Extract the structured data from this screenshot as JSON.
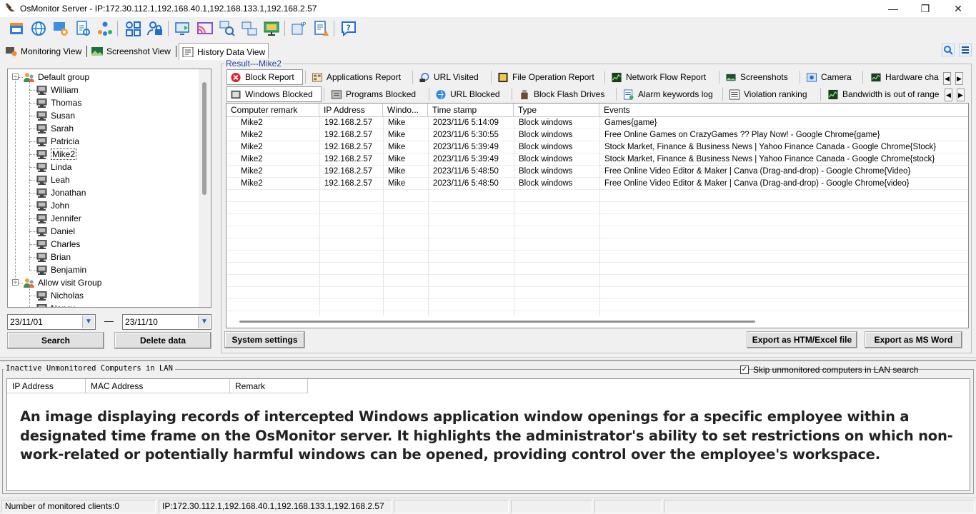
{
  "window": {
    "title": "OsMonitor Server  -  IP:172.30.112.1,192.168.40.1,192.168.133.1,192.168.2.57",
    "minimize_glyph": "—",
    "maximize_glyph": "❐",
    "close_glyph": "✕"
  },
  "toolbar": {
    "icons": [
      "app-window-icon",
      "globe-icon",
      "monitor-settings-icon",
      "document-scan-icon",
      "users-network-icon",
      "app-grid-icon",
      "lock-user-icon",
      "remote-screen-icon",
      "cast-icon",
      "search-network-icon",
      "network-computers-icon",
      "monitor-stand-icon",
      "ip-config-icon",
      "alarm-doc-icon",
      "help-icon"
    ]
  },
  "view_tabs": [
    {
      "label": "Monitoring View",
      "icon": "monitoring-icon",
      "active": false
    },
    {
      "label": "Screenshot View",
      "icon": "screenshot-icon",
      "active": false
    },
    {
      "label": "History Data View",
      "icon": "history-icon",
      "active": true
    }
  ],
  "tree": {
    "groups": [
      {
        "name": "Default group",
        "expander": "−",
        "members": [
          "William",
          "Thomas",
          "Susan",
          "Sarah",
          "Patricia",
          "Mike2",
          "Linda",
          "Leah",
          "Jonathan",
          "John",
          "Jennifer",
          "Daniel",
          "Charles",
          "Brian",
          "Benjamin"
        ]
      },
      {
        "name": "Allow visit Group",
        "expander": "−",
        "members": [
          "Nicholas",
          "Nancy"
        ]
      }
    ],
    "selected": "Mike2"
  },
  "date_range": {
    "from": "23/11/01",
    "to": "23/11/10",
    "separator": "—",
    "dropdown_glyph": "▼"
  },
  "buttons": {
    "search": "Search",
    "delete": "Delete data",
    "system_settings": "System settings",
    "export_html": "Export as HTM/Excel file",
    "export_word": "Export as MS Word"
  },
  "result": {
    "label": "Result---Mike2",
    "report_tabs_row1": [
      {
        "label": "Block Report",
        "icon": "block-icon",
        "active": true
      },
      {
        "label": "Applications Report",
        "icon": "applications-icon"
      },
      {
        "label": "URL Visited",
        "icon": "url-icon"
      },
      {
        "label": "File Operation Report",
        "icon": "file-operation-icon"
      },
      {
        "label": "Network Flow Report",
        "icon": "network-flow-icon"
      },
      {
        "label": "Screenshots",
        "icon": "screenshots-icon"
      },
      {
        "label": "Camera",
        "icon": "camera-icon"
      },
      {
        "label": "Hardware cha",
        "icon": "hardware-icon"
      }
    ],
    "report_tabs_row2": [
      {
        "label": "Windows Blocked",
        "icon": "windows-blocked-icon",
        "active": true
      },
      {
        "label": "Programs Blocked",
        "icon": "programs-blocked-icon"
      },
      {
        "label": "URL Blocked",
        "icon": "url-blocked-icon"
      },
      {
        "label": "Block Flash Drives",
        "icon": "flash-drive-icon"
      },
      {
        "label": "Alarm keywords log",
        "icon": "alarm-keywords-icon"
      },
      {
        "label": "Violation ranking",
        "icon": "violation-ranking-icon"
      },
      {
        "label": "Bandwidth is out of range",
        "icon": "bandwidth-icon"
      }
    ],
    "scroll_left": "◀",
    "scroll_right": "▶",
    "columns": [
      "Computer remark",
      "IP Address",
      "Windo...",
      "Time stamp",
      "Type",
      "Events"
    ],
    "rows": [
      [
        "Mike2",
        "192.168.2.57",
        "Mike",
        "2023/11/6 5:14:09",
        "Block windows",
        "Games{game}"
      ],
      [
        "Mike2",
        "192.168.2.57",
        "Mike",
        "2023/11/6 5:30:55",
        "Block windows",
        "Free Online Games on CrazyGames ?? Play Now! - Google Chrome{game}"
      ],
      [
        "Mike2",
        "192.168.2.57",
        "Mike",
        "2023/11/6 5:39:49",
        "Block windows",
        "Stock Market, Finance & Business News | Yahoo Finance Canada - Google Chrome{Stock}"
      ],
      [
        "Mike2",
        "192.168.2.57",
        "Mike",
        "2023/11/6 5:39:49",
        "Block windows",
        "Stock Market, Finance & Business News | Yahoo Finance Canada - Google Chrome{stock}"
      ],
      [
        "Mike2",
        "192.168.2.57",
        "Mike",
        "2023/11/6 5:48:50",
        "Block windows",
        "Free Online Video Editor & Maker | Canva (Drag-and-drop) - Google Chrome{Video}"
      ],
      [
        "Mike2",
        "192.168.2.57",
        "Mike",
        "2023/11/6 5:48:50",
        "Block windows",
        "Free Online Video Editor & Maker | Canva (Drag-and-drop) - Google Chrome{video}"
      ]
    ]
  },
  "lan_panel": {
    "label": "Inactive Unmonitored Computers in LAN",
    "skip_checkbox_label": "Skip unmonitored computers in LAN search",
    "skip_checked": true,
    "check_glyph": "✓",
    "columns": [
      "IP Address",
      "MAC Address",
      "Remark"
    ],
    "caption": "An image displaying records of intercepted Windows application window openings for a specific employee within a designated time frame on the OsMonitor server. It highlights the administrator's ability to set restrictions on which non-work-related or potentially harmful windows can be opened, providing control over the employee's workspace."
  },
  "statusbar": {
    "clients": "Number of monitored clients:0",
    "ips": "IP:172.30.112.1,192.168.40.1,192.168.133.1,192.168.2.57"
  },
  "colors": {
    "accent_blue": "#1f3f99",
    "block_red": "#d9232e",
    "window_bg": "#f0f0f0"
  }
}
